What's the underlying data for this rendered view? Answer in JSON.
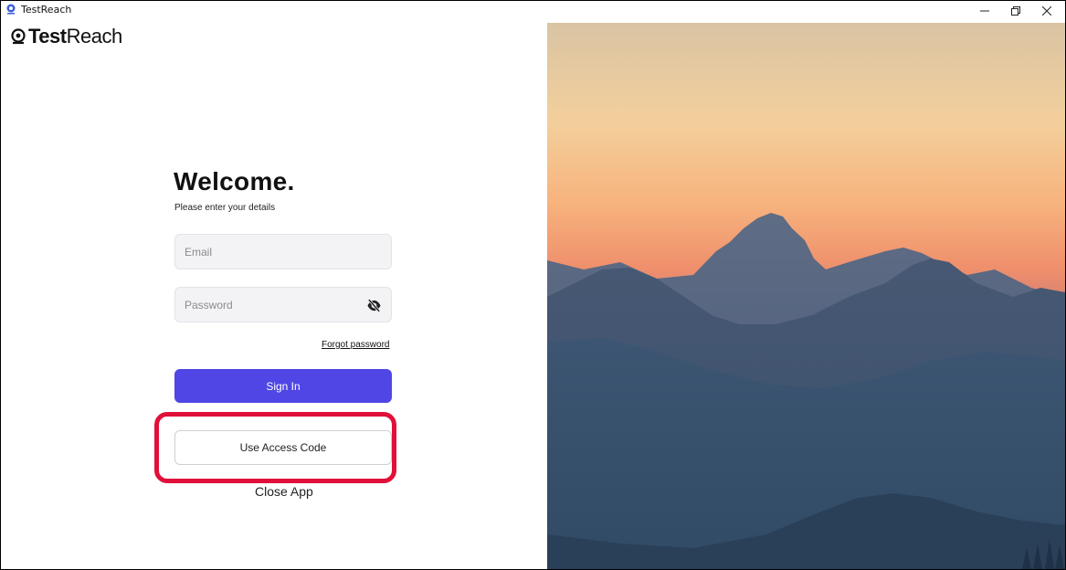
{
  "window": {
    "title": "TestReach",
    "minimize_icon": "minimize-icon",
    "restore_icon": "restore-icon",
    "close_icon": "close-icon"
  },
  "brand": {
    "bold": "Test",
    "regular": "Reach",
    "icon": "testreach-logo-icon",
    "color": "#111111"
  },
  "login": {
    "heading": "Welcome.",
    "subheading": "Please enter your details",
    "email_placeholder": "Email",
    "email_value": "",
    "password_placeholder": "Password",
    "password_value": "",
    "password_toggle_icon": "eye-slash-icon",
    "forgot_password": "Forgot password",
    "sign_in": "Sign In",
    "use_access_code": "Use Access Code",
    "close_app": "Close App"
  },
  "colors": {
    "primary": "#4f46e5",
    "highlight": "#e0103a",
    "field_bg": "#f3f3f6"
  },
  "scenery": {
    "description_icon": "mountain-sunset-image"
  }
}
